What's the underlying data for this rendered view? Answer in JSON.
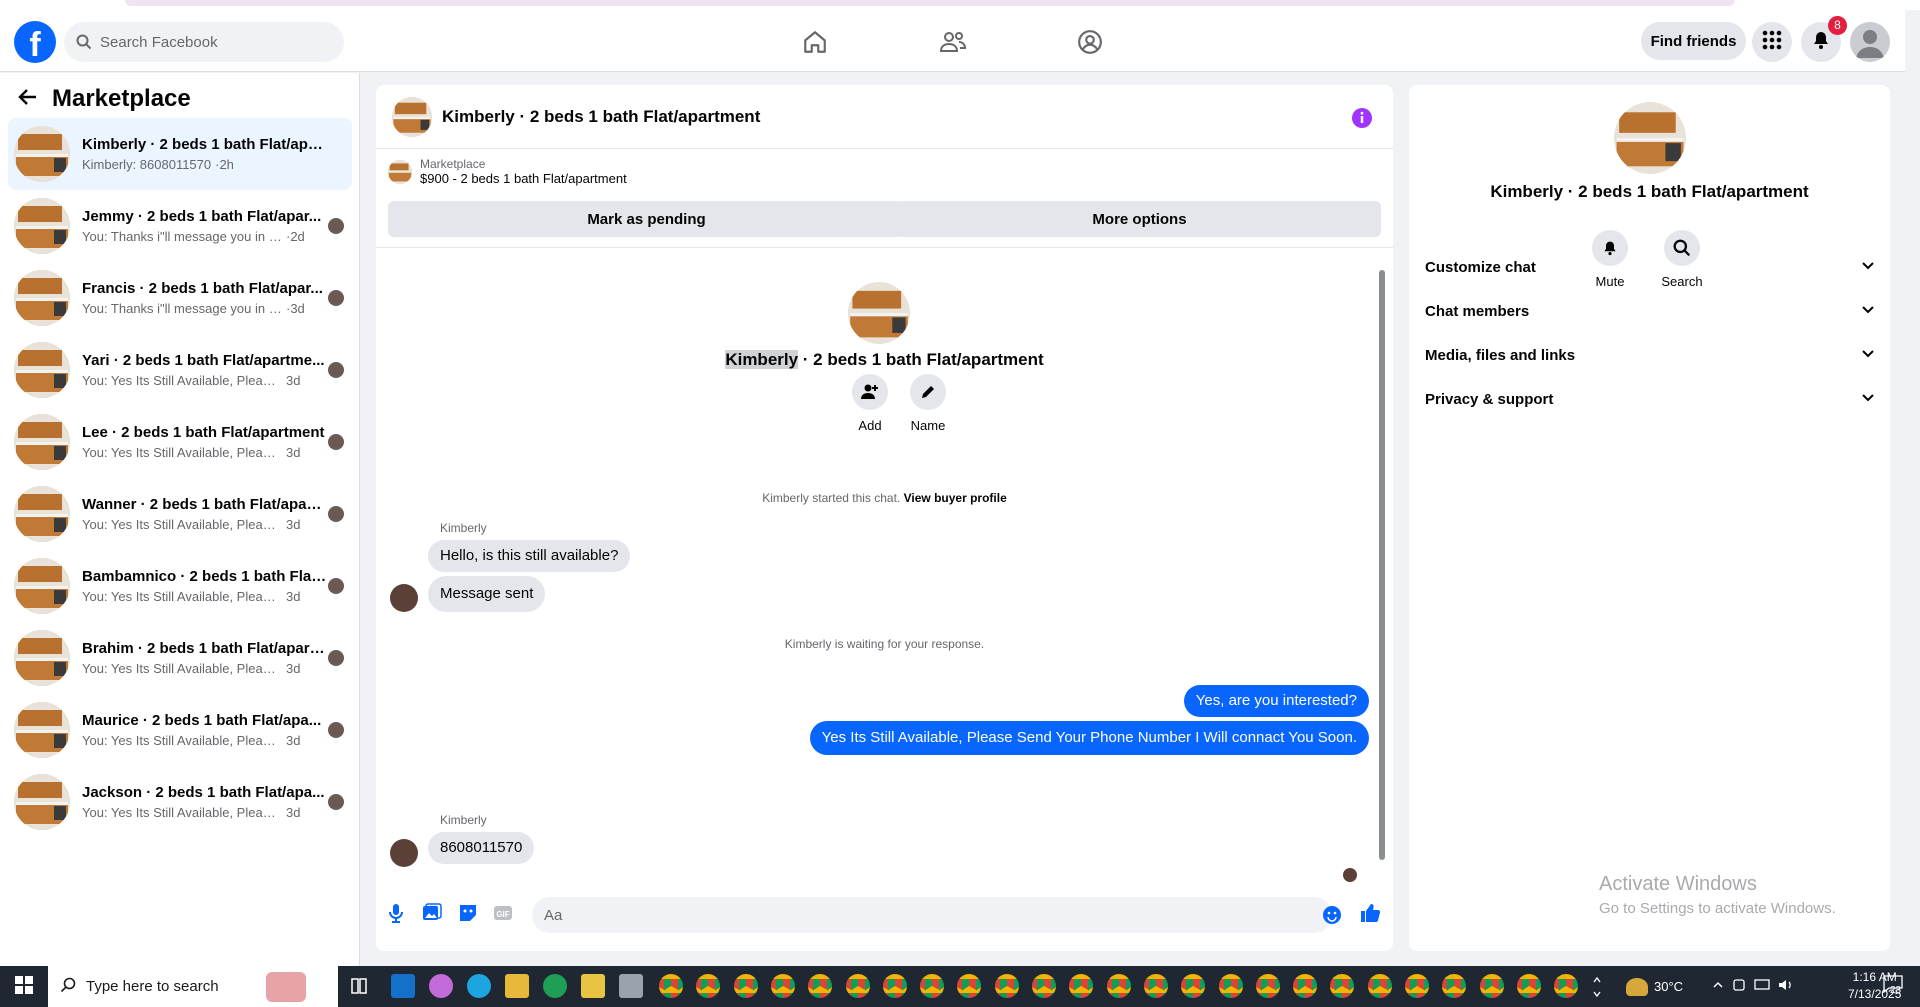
{
  "header": {
    "search_placeholder": "Search Facebook",
    "find_friends": "Find friends",
    "notif_count": "8"
  },
  "left": {
    "title": "Marketplace",
    "conversations": [
      {
        "title": "Kimberly · 2 beds 1 bath Flat/apart...",
        "snippet": "Kimberly: 8608011570",
        "time": "·2h",
        "active": true
      },
      {
        "title": "Jemmy · 2 beds 1 bath Flat/apar...",
        "snippet": "You: Thanks i\"ll message you in a ...",
        "time": "·2d"
      },
      {
        "title": "Francis · 2 beds 1 bath Flat/apar...",
        "snippet": "You: Thanks i\"ll message you in a ...",
        "time": "·3d"
      },
      {
        "title": "Yari · 2 beds 1 bath Flat/apartme...",
        "snippet": "You: Yes Its Still Available, Please Se...",
        "time": "3d"
      },
      {
        "title": "Lee · 2 beds 1 bath Flat/apartment",
        "snippet": "You: Yes Its Still Available, Please Se...",
        "time": "3d"
      },
      {
        "title": "Wanner · 2 beds 1 bath Flat/apart...",
        "snippet": "You: Yes Its Still Available, Please Send...",
        "time": "3d"
      },
      {
        "title": "Bambamnico · 2 beds 1 bath Flat...",
        "snippet": "You: Yes Its Still Available, Please Se...",
        "time": "3d"
      },
      {
        "title": "Brahim · 2 beds 1 bath Flat/apartm...",
        "snippet": "You: Yes Its Still Available, Please Send...",
        "time": "3d"
      },
      {
        "title": "Maurice · 2 beds 1 bath Flat/apa...",
        "snippet": "You: Yes Its Still Available, Please Se...",
        "time": "3d"
      },
      {
        "title": "Jackson · 2 beds 1 bath Flat/apa...",
        "snippet": "You: Yes Its Still Available, Please Se...",
        "time": "3d"
      }
    ]
  },
  "chat": {
    "title": "Kimberly · 2 beds 1 bath Flat/apartment",
    "listing_source": "Marketplace",
    "listing_desc": "$900 - 2 beds 1 bath Flat/apartment",
    "mark_pending": "Mark as pending",
    "more_options": "More options",
    "center_name_hl": "Kimberly",
    "center_name_rest": " · 2 beds 1 bath Flat/apartment",
    "add_label": "Add",
    "name_label": "Name",
    "started_text": "Kimberly started this chat. ",
    "view_buyer": "View buyer profile",
    "sender1": "Kimberly",
    "msg1": "Hello, is this still available?",
    "msg2": "Message sent",
    "waiting": "Kimberly is waiting for your response.",
    "out1": "Yes, are you interested?",
    "out2": "Yes Its Still Available, Please Send Your Phone Number I Will connact You Soon.",
    "sender2": "Kimberly",
    "msg3": "8608011570",
    "composer_placeholder": "Aa"
  },
  "right": {
    "title": "Kimberly · 2 beds 1 bath Flat/apartment",
    "mute": "Mute",
    "search": "Search",
    "sections": [
      "Customize chat",
      "Chat members",
      "Media, files and links",
      "Privacy & support"
    ],
    "watermark_title": "Activate Windows",
    "watermark_sub": "Go to Settings to activate Windows."
  },
  "taskbar": {
    "search_placeholder": "Type here to search",
    "temperature": "30°C",
    "time": "1:16 AM",
    "date": "7/13/2025",
    "notif_count": "23"
  },
  "colors": {
    "accent": "#0866ff",
    "active_bg": "#ebf5ff",
    "info": "#a033ff"
  }
}
